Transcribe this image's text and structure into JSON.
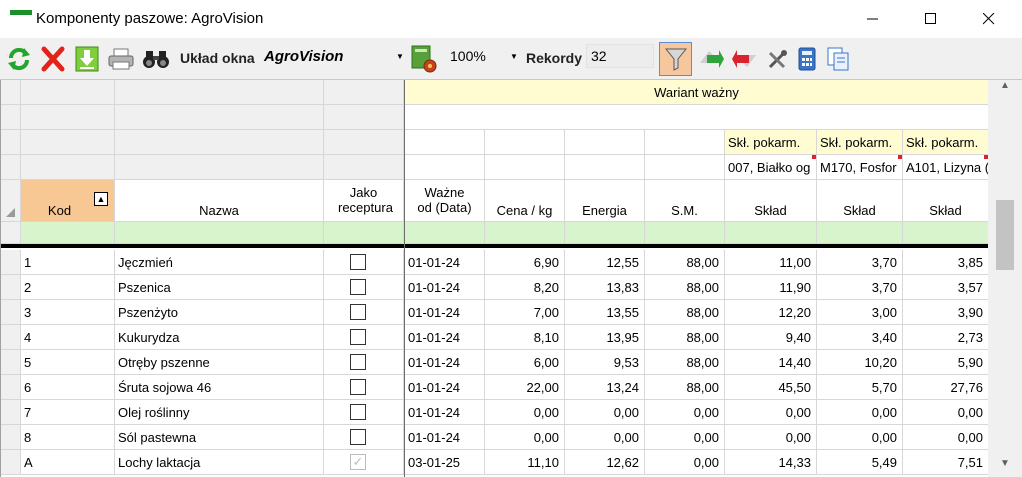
{
  "window": {
    "title": "Komponenty paszowe: AgroVision",
    "accent": "#1b8f2a"
  },
  "toolbar": {
    "layout_label": "Układ okna",
    "layout_value": "AgroVision",
    "zoom_value": "100%",
    "records_label": "Rekordy",
    "records_value": "32",
    "icons": [
      "refresh-icon",
      "delete-icon",
      "export-icon",
      "print-icon",
      "binoculars-icon",
      "layout-settings-icon",
      "filter-icon",
      "nav-forward-icon",
      "nav-back-icon",
      "tools-icon",
      "calculator-icon",
      "copy-icon"
    ]
  },
  "grid": {
    "group_header": "Wariant ważny",
    "nutrient_headers": [
      "Skł. pokarm.",
      "Skł. pokarm.",
      "Skł. pokarm."
    ],
    "nutrient_names": [
      "007, Białko og",
      "M170, Fosfor",
      "A101, Lizyna ("
    ],
    "columns": [
      "Kod",
      "Nazwa",
      "Jako receptura",
      "Ważne od (Data)",
      "Cena / kg",
      "Energia",
      "S.M.",
      "Skład",
      "Skład",
      "Skład"
    ],
    "rows": [
      {
        "kod": "1",
        "nazwa": "Jęczmień",
        "receptura": false,
        "data": "01-01-24",
        "cena": "6,90",
        "energia": "12,55",
        "sm": "88,00",
        "s1": "11,00",
        "s2": "3,70",
        "s3": "3,85"
      },
      {
        "kod": "2",
        "nazwa": "Pszenica",
        "receptura": false,
        "data": "01-01-24",
        "cena": "8,20",
        "energia": "13,83",
        "sm": "88,00",
        "s1": "11,90",
        "s2": "3,70",
        "s3": "3,57"
      },
      {
        "kod": "3",
        "nazwa": "Pszenżyto",
        "receptura": false,
        "data": "01-01-24",
        "cena": "7,00",
        "energia": "13,55",
        "sm": "88,00",
        "s1": "12,20",
        "s2": "3,00",
        "s3": "3,90"
      },
      {
        "kod": "4",
        "nazwa": "Kukurydza",
        "receptura": false,
        "data": "01-01-24",
        "cena": "8,10",
        "energia": "13,95",
        "sm": "88,00",
        "s1": "9,40",
        "s2": "3,40",
        "s3": "2,73"
      },
      {
        "kod": "5",
        "nazwa": "Otręby pszenne",
        "receptura": false,
        "data": "01-01-24",
        "cena": "6,00",
        "energia": "9,53",
        "sm": "88,00",
        "s1": "14,40",
        "s2": "10,20",
        "s3": "5,90"
      },
      {
        "kod": "6",
        "nazwa": "Śruta sojowa 46",
        "receptura": false,
        "data": "01-01-24",
        "cena": "22,00",
        "energia": "13,24",
        "sm": "88,00",
        "s1": "45,50",
        "s2": "5,70",
        "s3": "27,76"
      },
      {
        "kod": "7",
        "nazwa": "Olej roślinny",
        "receptura": false,
        "data": "01-01-24",
        "cena": "0,00",
        "energia": "0,00",
        "sm": "0,00",
        "s1": "0,00",
        "s2": "0,00",
        "s3": "0,00"
      },
      {
        "kod": "8",
        "nazwa": "Sól pastewna",
        "receptura": false,
        "data": "01-01-24",
        "cena": "0,00",
        "energia": "0,00",
        "sm": "0,00",
        "s1": "0,00",
        "s2": "0,00",
        "s3": "0,00"
      },
      {
        "kod": "A",
        "nazwa": "Lochy laktacja",
        "receptura": true,
        "data": "03-01-25",
        "cena": "11,10",
        "energia": "12,62",
        "sm": "0,00",
        "s1": "14,33",
        "s2": "5,49",
        "s3": "7,51"
      }
    ]
  }
}
